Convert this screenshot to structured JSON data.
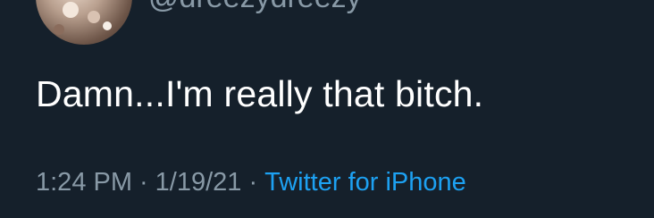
{
  "tweet": {
    "handle": "@dreezydreezy",
    "text": "Damn...I'm really that bitch.",
    "time": "1:24 PM",
    "date": "1/19/21",
    "source": "Twitter for iPhone",
    "separator": "·"
  },
  "colors": {
    "background": "#15202b",
    "text": "#ffffff",
    "muted": "#8899a6",
    "link": "#1da1f2"
  }
}
